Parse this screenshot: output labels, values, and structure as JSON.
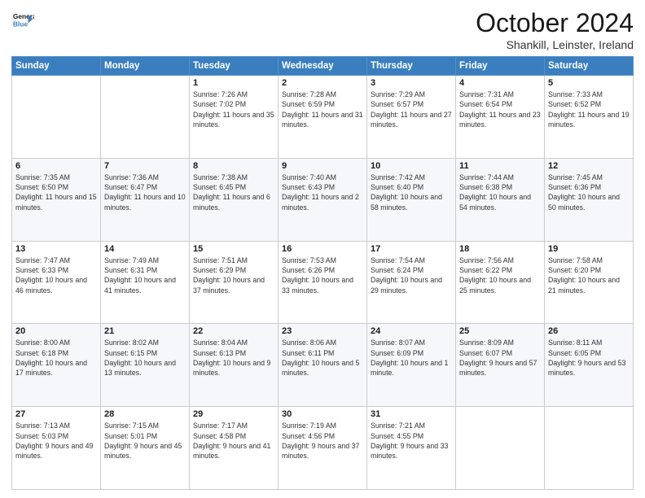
{
  "logo": {
    "line1": "General",
    "line2": "Blue"
  },
  "title": "October 2024",
  "location": "Shankill, Leinster, Ireland",
  "weekdays": [
    "Sunday",
    "Monday",
    "Tuesday",
    "Wednesday",
    "Thursday",
    "Friday",
    "Saturday"
  ],
  "weeks": [
    [
      {
        "day": "",
        "content": ""
      },
      {
        "day": "",
        "content": ""
      },
      {
        "day": "1",
        "content": "Sunrise: 7:26 AM\nSunset: 7:02 PM\nDaylight: 11 hours and 35 minutes."
      },
      {
        "day": "2",
        "content": "Sunrise: 7:28 AM\nSunset: 6:59 PM\nDaylight: 11 hours and 31 minutes."
      },
      {
        "day": "3",
        "content": "Sunrise: 7:29 AM\nSunset: 6:57 PM\nDaylight: 11 hours and 27 minutes."
      },
      {
        "day": "4",
        "content": "Sunrise: 7:31 AM\nSunset: 6:54 PM\nDaylight: 11 hours and 23 minutes."
      },
      {
        "day": "5",
        "content": "Sunrise: 7:33 AM\nSunset: 6:52 PM\nDaylight: 11 hours and 19 minutes."
      }
    ],
    [
      {
        "day": "6",
        "content": "Sunrise: 7:35 AM\nSunset: 6:50 PM\nDaylight: 11 hours and 15 minutes."
      },
      {
        "day": "7",
        "content": "Sunrise: 7:36 AM\nSunset: 6:47 PM\nDaylight: 11 hours and 10 minutes."
      },
      {
        "day": "8",
        "content": "Sunrise: 7:38 AM\nSunset: 6:45 PM\nDaylight: 11 hours and 6 minutes."
      },
      {
        "day": "9",
        "content": "Sunrise: 7:40 AM\nSunset: 6:43 PM\nDaylight: 11 hours and 2 minutes."
      },
      {
        "day": "10",
        "content": "Sunrise: 7:42 AM\nSunset: 6:40 PM\nDaylight: 10 hours and 58 minutes."
      },
      {
        "day": "11",
        "content": "Sunrise: 7:44 AM\nSunset: 6:38 PM\nDaylight: 10 hours and 54 minutes."
      },
      {
        "day": "12",
        "content": "Sunrise: 7:45 AM\nSunset: 6:36 PM\nDaylight: 10 hours and 50 minutes."
      }
    ],
    [
      {
        "day": "13",
        "content": "Sunrise: 7:47 AM\nSunset: 6:33 PM\nDaylight: 10 hours and 46 minutes."
      },
      {
        "day": "14",
        "content": "Sunrise: 7:49 AM\nSunset: 6:31 PM\nDaylight: 10 hours and 41 minutes."
      },
      {
        "day": "15",
        "content": "Sunrise: 7:51 AM\nSunset: 6:29 PM\nDaylight: 10 hours and 37 minutes."
      },
      {
        "day": "16",
        "content": "Sunrise: 7:53 AM\nSunset: 6:26 PM\nDaylight: 10 hours and 33 minutes."
      },
      {
        "day": "17",
        "content": "Sunrise: 7:54 AM\nSunset: 6:24 PM\nDaylight: 10 hours and 29 minutes."
      },
      {
        "day": "18",
        "content": "Sunrise: 7:56 AM\nSunset: 6:22 PM\nDaylight: 10 hours and 25 minutes."
      },
      {
        "day": "19",
        "content": "Sunrise: 7:58 AM\nSunset: 6:20 PM\nDaylight: 10 hours and 21 minutes."
      }
    ],
    [
      {
        "day": "20",
        "content": "Sunrise: 8:00 AM\nSunset: 6:18 PM\nDaylight: 10 hours and 17 minutes."
      },
      {
        "day": "21",
        "content": "Sunrise: 8:02 AM\nSunset: 6:15 PM\nDaylight: 10 hours and 13 minutes."
      },
      {
        "day": "22",
        "content": "Sunrise: 8:04 AM\nSunset: 6:13 PM\nDaylight: 10 hours and 9 minutes."
      },
      {
        "day": "23",
        "content": "Sunrise: 8:06 AM\nSunset: 6:11 PM\nDaylight: 10 hours and 5 minutes."
      },
      {
        "day": "24",
        "content": "Sunrise: 8:07 AM\nSunset: 6:09 PM\nDaylight: 10 hours and 1 minute."
      },
      {
        "day": "25",
        "content": "Sunrise: 8:09 AM\nSunset: 6:07 PM\nDaylight: 9 hours and 57 minutes."
      },
      {
        "day": "26",
        "content": "Sunrise: 8:11 AM\nSunset: 6:05 PM\nDaylight: 9 hours and 53 minutes."
      }
    ],
    [
      {
        "day": "27",
        "content": "Sunrise: 7:13 AM\nSunset: 5:03 PM\nDaylight: 9 hours and 49 minutes."
      },
      {
        "day": "28",
        "content": "Sunrise: 7:15 AM\nSunset: 5:01 PM\nDaylight: 9 hours and 45 minutes."
      },
      {
        "day": "29",
        "content": "Sunrise: 7:17 AM\nSunset: 4:58 PM\nDaylight: 9 hours and 41 minutes."
      },
      {
        "day": "30",
        "content": "Sunrise: 7:19 AM\nSunset: 4:56 PM\nDaylight: 9 hours and 37 minutes."
      },
      {
        "day": "31",
        "content": "Sunrise: 7:21 AM\nSunset: 4:55 PM\nDaylight: 9 hours and 33 minutes."
      },
      {
        "day": "",
        "content": ""
      },
      {
        "day": "",
        "content": ""
      }
    ]
  ]
}
